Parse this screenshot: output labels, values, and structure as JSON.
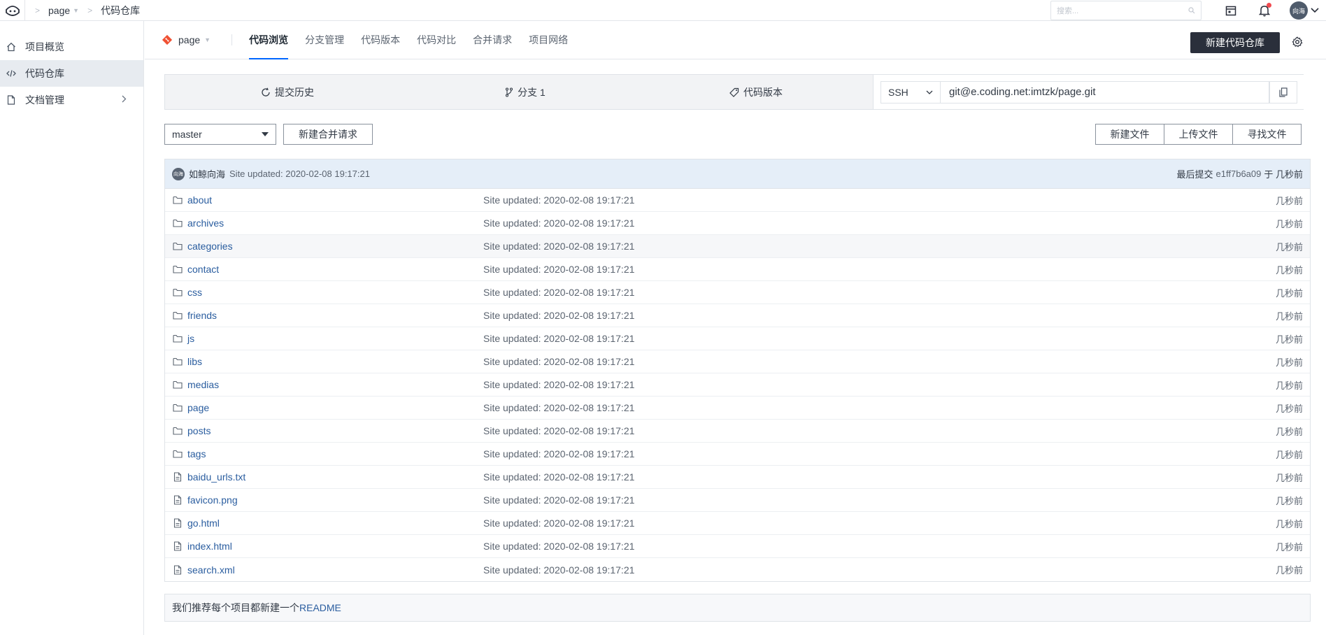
{
  "topbar": {
    "crumbs": [
      "page",
      "代码仓库"
    ],
    "search_placeholder": "搜索...",
    "avatar_text": "向海"
  },
  "sidebar": {
    "items": [
      {
        "label": "项目概览",
        "icon": "home-icon"
      },
      {
        "label": "代码仓库",
        "icon": "code-icon"
      },
      {
        "label": "文档管理",
        "icon": "document-icon"
      }
    ]
  },
  "subheader": {
    "repo_name": "page",
    "tabs": [
      "代码浏览",
      "分支管理",
      "代码版本",
      "代码对比",
      "合并请求",
      "项目网络"
    ],
    "new_repo_label": "新建代码仓库"
  },
  "infobar": {
    "history_label": "提交历史",
    "branch_label": "分支 1",
    "tags_label": "代码版本",
    "protocol": "SSH",
    "clone_url": "git@e.coding.net:imtzk/page.git"
  },
  "actions": {
    "branch": "master",
    "merge_request_label": "新建合并请求",
    "new_file_label": "新建文件",
    "upload_file_label": "上传文件",
    "find_file_label": "寻找文件"
  },
  "commit": {
    "avatar_text": "向海",
    "author": "如鲸向海",
    "message": "Site updated: 2020-02-08 19:17:21",
    "last_commit_label": "最后提交",
    "hash": "e1ff7b6a09",
    "time": "于 几秒前"
  },
  "files": [
    {
      "name": "about",
      "type": "folder",
      "message": "Site updated: 2020-02-08 19:17:21",
      "time": "几秒前"
    },
    {
      "name": "archives",
      "type": "folder",
      "message": "Site updated: 2020-02-08 19:17:21",
      "time": "几秒前"
    },
    {
      "name": "categories",
      "type": "folder",
      "message": "Site updated: 2020-02-08 19:17:21",
      "time": "几秒前"
    },
    {
      "name": "contact",
      "type": "folder",
      "message": "Site updated: 2020-02-08 19:17:21",
      "time": "几秒前"
    },
    {
      "name": "css",
      "type": "folder",
      "message": "Site updated: 2020-02-08 19:17:21",
      "time": "几秒前"
    },
    {
      "name": "friends",
      "type": "folder",
      "message": "Site updated: 2020-02-08 19:17:21",
      "time": "几秒前"
    },
    {
      "name": "js",
      "type": "folder",
      "message": "Site updated: 2020-02-08 19:17:21",
      "time": "几秒前"
    },
    {
      "name": "libs",
      "type": "folder",
      "message": "Site updated: 2020-02-08 19:17:21",
      "time": "几秒前"
    },
    {
      "name": "medias",
      "type": "folder",
      "message": "Site updated: 2020-02-08 19:17:21",
      "time": "几秒前"
    },
    {
      "name": "page",
      "type": "folder",
      "message": "Site updated: 2020-02-08 19:17:21",
      "time": "几秒前"
    },
    {
      "name": "posts",
      "type": "folder",
      "message": "Site updated: 2020-02-08 19:17:21",
      "time": "几秒前"
    },
    {
      "name": "tags",
      "type": "folder",
      "message": "Site updated: 2020-02-08 19:17:21",
      "time": "几秒前"
    },
    {
      "name": "baidu_urls.txt",
      "type": "file",
      "message": "Site updated: 2020-02-08 19:17:21",
      "time": "几秒前"
    },
    {
      "name": "favicon.png",
      "type": "file",
      "message": "Site updated: 2020-02-08 19:17:21",
      "time": "几秒前"
    },
    {
      "name": "go.html",
      "type": "file",
      "message": "Site updated: 2020-02-08 19:17:21",
      "time": "几秒前"
    },
    {
      "name": "index.html",
      "type": "file",
      "message": "Site updated: 2020-02-08 19:17:21",
      "time": "几秒前"
    },
    {
      "name": "search.xml",
      "type": "file",
      "message": "Site updated: 2020-02-08 19:17:21",
      "time": "几秒前"
    }
  ],
  "readme_tip": {
    "text": "我们推荐每个项目都新建一个",
    "link": "README"
  },
  "colors": {
    "accent": "#0066ff",
    "primary_button": "#2a2f3b",
    "link": "#2a5d9f",
    "notification_dot": "#f0494f"
  }
}
